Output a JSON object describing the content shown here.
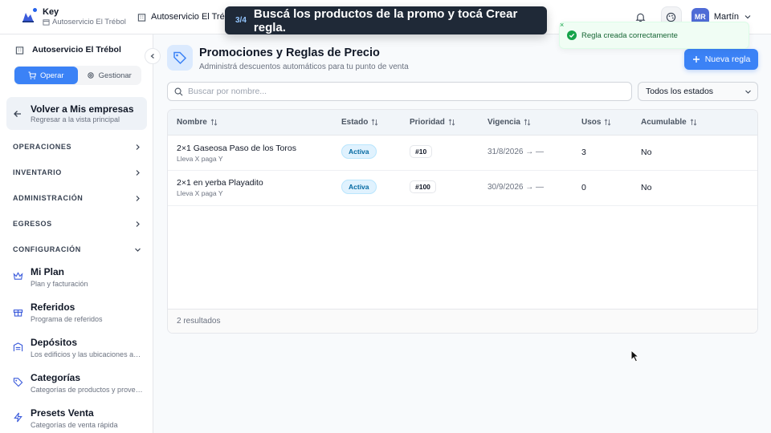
{
  "topbar": {
    "brand_title": "Key",
    "brand_store": "Autoservicio El Trébol",
    "store_selector": "Autoservicio El Trébol",
    "user_initials": "MR",
    "user_name": "Martín",
    "icons": [
      "bell-icon",
      "palette-icon",
      "chevron-down-icon"
    ]
  },
  "tour": {
    "step": "3/4",
    "message": "Buscá los productos de la promo y tocá Crear regla."
  },
  "toast": {
    "close": "×",
    "message": "Regla creada correctamente",
    "color": "#16a34a"
  },
  "sidebar": {
    "store_name": "Autoservicio El Trébol",
    "modes": {
      "operate": "Operar",
      "manage": "Gestionar"
    },
    "back": {
      "title": "Volver a Mis empresas",
      "subtitle": "Regresar a la vista principal"
    },
    "sections": [
      "OPERACIONES",
      "INVENTARIO",
      "ADMINISTRACIÓN",
      "EGRESOS",
      "CONFIGURACIÓN"
    ],
    "items": [
      {
        "title": "Mi Plan",
        "subtitle": "Plan y facturación",
        "icon": "crown-icon"
      },
      {
        "title": "Referidos",
        "subtitle": "Programa de referidos",
        "icon": "gift-icon"
      },
      {
        "title": "Depósitos",
        "subtitle": "Los edificios y las ubicaciones ad...",
        "icon": "warehouse-icon"
      },
      {
        "title": "Categorías",
        "subtitle": "Categorías de productos y provee...",
        "icon": "tag-icon"
      },
      {
        "title": "Presets Venta",
        "subtitle": "Categorías de venta rápida",
        "icon": "bolt-icon"
      }
    ]
  },
  "main": {
    "title": "Promociones y Reglas de Precio",
    "subtitle": "Administrá descuentos automáticos para tu punto de venta",
    "new_button": "Nueva regla",
    "search_placeholder": "Buscar por nombre...",
    "status_filter": "Todos los estados",
    "columns": [
      "Nombre",
      "Estado",
      "Prioridad",
      "Vigencia",
      "Usos",
      "Acumulable"
    ],
    "rows": [
      {
        "name": "2×1 Gaseosa Paso de los Toros",
        "desc": "Lleva X paga Y",
        "status": "Activa",
        "priority": "#10",
        "validity": "31/8/2026 → —",
        "uses": "3",
        "stackable": "No"
      },
      {
        "name": "2×1 en yerba Playadito",
        "desc": "Lleva X paga Y",
        "status": "Activa",
        "priority": "#100",
        "validity": "30/9/2026 → —",
        "uses": "0",
        "stackable": "No"
      }
    ],
    "results": "2 resultados"
  },
  "colors": {
    "accent": "#3b82f6",
    "success": "#16a34a",
    "badge": "#0369a1"
  }
}
